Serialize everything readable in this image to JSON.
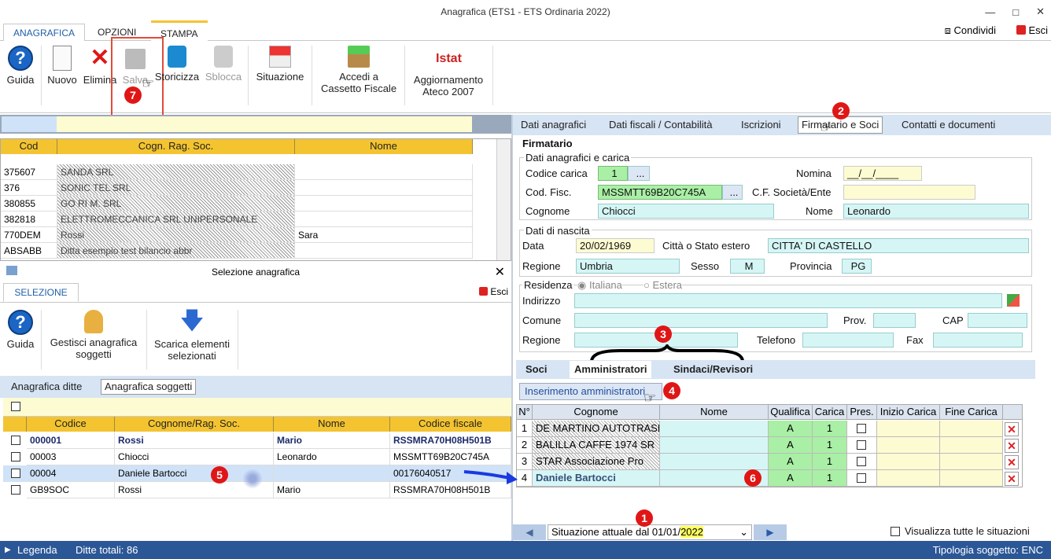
{
  "window": {
    "title": "Anagrafica (ETS1 - ETS Ordinaria 2022)",
    "condividi": "Condividi",
    "esci": "Esci"
  },
  "ribbon_tabs": [
    "ANAGRAFICA",
    "OPZIONI",
    "STAMPA"
  ],
  "ribbon_buttons": {
    "guida": "Guida",
    "nuovo": "Nuovo",
    "elimina": "Elimina",
    "salva": "Salva",
    "storicizza": "Storicizza",
    "sblocca": "Sblocca",
    "situazione": "Situazione",
    "cassetto1": "Accedi a",
    "cassetto2": "Cassetto Fiscale",
    "istat_logo": "Istat",
    "ateco1": "Aggiornamento",
    "ateco2": "Ateco 2007"
  },
  "top_grid": {
    "headers": [
      "Cod",
      "Cogn. Rag. Soc.",
      "Nome"
    ],
    "rows": [
      [
        "375607",
        "SANDA SRL",
        ""
      ],
      [
        "376",
        "SONIC TEL SRL",
        ""
      ],
      [
        "380855",
        "GO RI M. SRL",
        ""
      ],
      [
        "382818",
        "ELETTROMECCANICA SRL UNIPERSONALE",
        ""
      ],
      [
        "770DEM",
        "Rossi",
        "Sara"
      ],
      [
        "ABSABB",
        "Ditta esempio test bilancio abbr",
        ""
      ]
    ]
  },
  "selezione": {
    "title": "Selezione anagrafica",
    "tab": "SELEZIONE",
    "esci": "Esci",
    "guida": "Guida",
    "gestisci1": "Gestisci anagrafica",
    "gestisci2": "soggetti",
    "scarica1": "Scarica elementi",
    "scarica2": "selezionati",
    "subtab1": "Anagrafica ditte",
    "subtab2": "Anagrafica soggetti"
  },
  "bottom_grid": {
    "headers": [
      "Codice",
      "Cognome/Rag. Soc.",
      "Nome",
      "Codice fiscale"
    ],
    "rows": [
      [
        "000001",
        "Rossi",
        "Mario",
        "RSSMRA70H08H501B"
      ],
      [
        "00003",
        "Chiocci",
        "Leonardo",
        "MSSMTT69B20C745A"
      ],
      [
        "00004",
        "Daniele Bartocci",
        "",
        "00176040517"
      ],
      [
        "GB9SOC",
        "Rossi",
        "Mario",
        "RSSMRA70H08H501B"
      ]
    ]
  },
  "right_tabs": [
    "Dati anagrafici",
    "Dati fiscali / Contabilità",
    "Iscrizioni",
    "Firmatario e Soci",
    "Contatti e documenti"
  ],
  "firmatario": {
    "section": "Firmatario",
    "sub1": "Dati anagrafici e carica",
    "codice_carica_label": "Codice carica",
    "codice_carica": "1",
    "dots": "...",
    "nomina_label": "Nomina",
    "nomina": "__/__/____",
    "codfisc_label": "Cod. Fisc.",
    "codfisc": "MSSMTT69B20C745A",
    "cf_soc_label": "C.F. Società/Ente",
    "cognome_label": "Cognome",
    "cognome": "Chiocci",
    "nome_label": "Nome",
    "nome": "Leonardo",
    "sub2": "Dati di nascita",
    "data_label": "Data",
    "data": "20/02/1969",
    "citta_label": "Città o Stato estero",
    "citta": "CITTA' DI CASTELLO",
    "regione_label": "Regione",
    "regione": "Umbria",
    "sesso_label": "Sesso",
    "sesso": "M",
    "provincia_label": "Provincia",
    "provincia": "PG",
    "residenza_label": "Residenza",
    "italiana": "Italiana",
    "estera": "Estera",
    "indirizzo_label": "Indirizzo",
    "comune_label": "Comune",
    "prov_label": "Prov.",
    "cap_label": "CAP",
    "regione2_label": "Regione",
    "telefono_label": "Telefono",
    "fax_label": "Fax"
  },
  "soci_tabs": [
    "Soci",
    "Amministratori",
    "Sindaci/Revisori"
  ],
  "ins_button": "Inserimento amministratori",
  "admin_grid": {
    "headers": [
      "N°",
      "Cognome",
      "Nome",
      "Qualifica",
      "Carica",
      "Pres.",
      "Inizio Carica",
      "Fine Carica"
    ],
    "rows": [
      [
        "1",
        "DE MARTINO AUTOTRASP",
        "",
        "A",
        "1"
      ],
      [
        "2",
        "BALILLA CAFFE 1974 SR",
        "",
        "A",
        "1"
      ],
      [
        "3",
        "STAR Associazione Pro",
        "",
        "A",
        "1"
      ],
      [
        "4",
        "Daniele Bartocci",
        "",
        "A",
        "1"
      ]
    ]
  },
  "footer": {
    "situazione": "Situazione attuale dal 01/01/",
    "anno": "2022",
    "visualizza": "Visualizza tutte le situazioni"
  },
  "status": {
    "legenda": "Legenda",
    "ditte": "Ditte totali: 86",
    "tipologia": "Tipologia soggetto: ENC"
  },
  "badges": [
    "1",
    "2",
    "3",
    "4",
    "5",
    "6",
    "7"
  ]
}
